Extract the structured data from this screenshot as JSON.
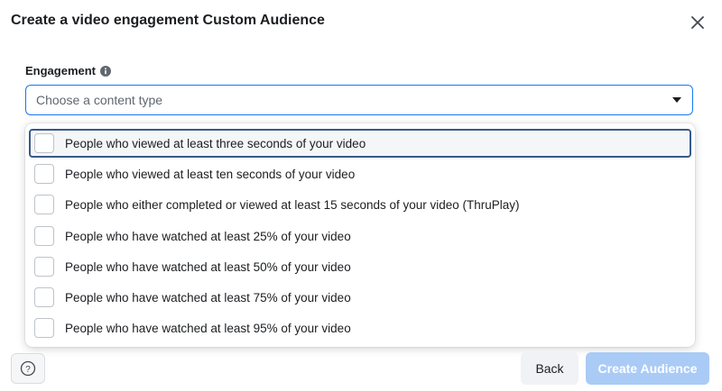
{
  "dialog": {
    "title": "Create a video engagement Custom Audience"
  },
  "engagement": {
    "label": "Engagement",
    "select_placeholder": "Choose a content type",
    "options": [
      {
        "label": "People who viewed at least three seconds of your video",
        "checked": false,
        "highlighted": true
      },
      {
        "label": "People who viewed at least ten seconds of your video",
        "checked": false
      },
      {
        "label": "People who either completed or viewed at least 15 seconds of your video (ThruPlay)",
        "checked": false
      },
      {
        "label": "People who have watched at least 25% of your video",
        "checked": false
      },
      {
        "label": "People who have watched at least 50% of your video",
        "checked": false
      },
      {
        "label": "People who have watched at least 75% of your video",
        "checked": false
      },
      {
        "label": "People who have watched at least 95% of your video",
        "checked": false
      }
    ]
  },
  "footer": {
    "help_label": "?",
    "back_label": "Back",
    "create_label": "Create Audience",
    "create_disabled": true
  },
  "icons": {
    "close": "close-icon",
    "info": "info-icon",
    "caret": "caret-down-icon",
    "help": "help-icon"
  },
  "colors": {
    "accent": "#1877f2",
    "create_disabled_bg": "#a9cbf5",
    "highlight_border": "#375a8a"
  }
}
